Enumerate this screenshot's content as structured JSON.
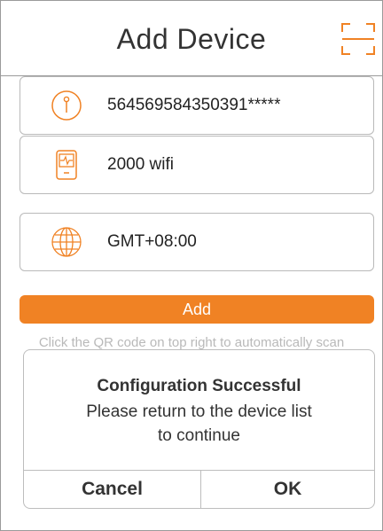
{
  "header": {
    "title": "Add Device",
    "scan_icon": "qr-scan-icon"
  },
  "fields": {
    "device_id": {
      "icon": "device-id-icon",
      "value": "564569584350391*****"
    },
    "device_model": {
      "icon": "device-model-icon",
      "value": "2000 wifi"
    },
    "timezone": {
      "icon": "globe-icon",
      "value": "GMT+08:00"
    }
  },
  "add_button": {
    "label": "Add"
  },
  "hint": "Click the QR code on top right to automatically scan",
  "dialog": {
    "title": "Configuration Successful",
    "message_line1": "Please return to the device list",
    "message_line2": "to continue",
    "cancel_label": "Cancel",
    "ok_label": "OK"
  },
  "colors": {
    "accent": "#f08224",
    "border": "#b9b9b9",
    "text": "#333333"
  }
}
